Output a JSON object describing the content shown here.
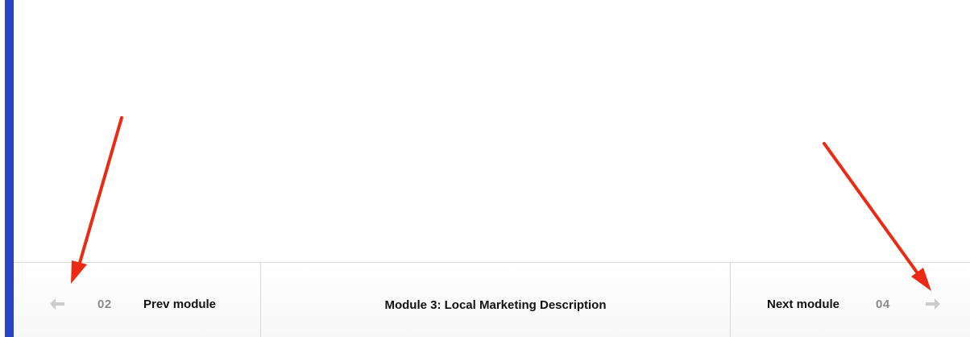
{
  "colors": {
    "accent": "#2a44c4",
    "annotation_arrow": "#ea2a12",
    "nav_arrow": "#cccccc"
  },
  "footer": {
    "prev": {
      "number": "02",
      "label": "Prev module",
      "icon": "arrow-left-icon"
    },
    "title": "Module 3: Local Marketing Description",
    "next": {
      "label": "Next module",
      "number": "04",
      "icon": "arrow-right-icon"
    }
  },
  "annotations": {
    "icon": "red-arrow-annotation"
  }
}
